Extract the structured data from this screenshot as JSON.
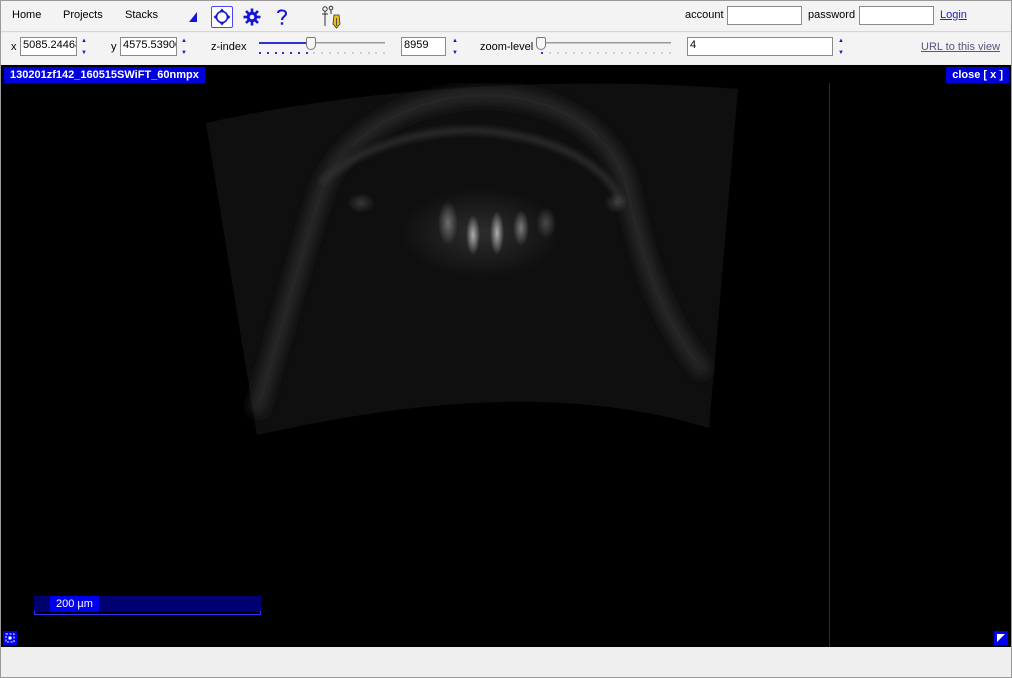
{
  "menu": {
    "home": "Home",
    "projects": "Projects",
    "stacks": "Stacks"
  },
  "tools": {
    "prev": "triangle-left-icon",
    "navigate": "move-crosshair-icon",
    "settings": "gear-icon",
    "help": "question-mark-icon",
    "trace": "pen-tool-icon"
  },
  "login": {
    "account_label": "account",
    "account_value": "",
    "password_label": "password",
    "password_value": "",
    "login_link": "Login"
  },
  "navigator": {
    "x_label": "x",
    "x_value": "5085.24468",
    "y_label": "y",
    "y_value": "4575.53900",
    "z_label": "z-index",
    "z_value": "8959",
    "z_slider_fraction": 0.41,
    "zoom_label": "zoom-level",
    "zoom_value": "4",
    "zoom_slider_fraction": 0.0,
    "url_link": "URL to this view"
  },
  "viewer": {
    "title": "130201zf142_160515SWiFT_60nmpx",
    "close": "close [ x ]",
    "scale_label": "200 µm",
    "corner_left_icon": "fullscreen-icon",
    "corner_right_icon": "resize-icon"
  },
  "colors": {
    "accent": "#0000dd",
    "viewer_bg": "#000000",
    "link": "#2020d0"
  }
}
